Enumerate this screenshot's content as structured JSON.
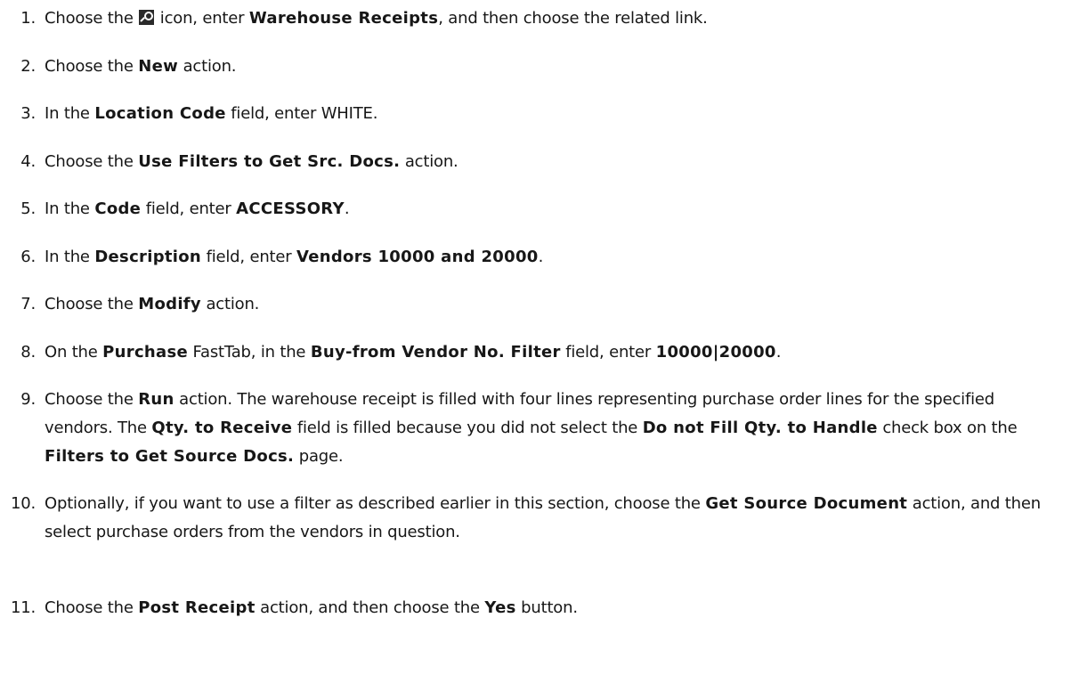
{
  "steps": [
    {
      "number": "1.",
      "parts": [
        {
          "t": "Choose the "
        },
        {
          "icon": "search-icon"
        },
        {
          "t": " icon, enter "
        },
        {
          "b": "Warehouse Receipts"
        },
        {
          "t": ", and then choose the related link."
        }
      ]
    },
    {
      "number": "2.",
      "parts": [
        {
          "t": "Choose the "
        },
        {
          "b": "New"
        },
        {
          "t": " action."
        }
      ]
    },
    {
      "number": "3.",
      "parts": [
        {
          "t": "In the "
        },
        {
          "b": "Location Code"
        },
        {
          "t": " field, enter WHITE."
        }
      ]
    },
    {
      "number": "4.",
      "parts": [
        {
          "t": "Choose the "
        },
        {
          "b": "Use Filters to Get Src. Docs."
        },
        {
          "t": " action."
        }
      ]
    },
    {
      "number": "5.",
      "parts": [
        {
          "t": "In the "
        },
        {
          "b": "Code"
        },
        {
          "t": " field, enter "
        },
        {
          "b": "ACCESSORY"
        },
        {
          "t": "."
        }
      ]
    },
    {
      "number": "6.",
      "parts": [
        {
          "t": "In the "
        },
        {
          "b": "Description"
        },
        {
          "t": " field, enter "
        },
        {
          "b": "Vendors 10000 and 20000"
        },
        {
          "t": "."
        }
      ]
    },
    {
      "number": "7.",
      "parts": [
        {
          "t": "Choose the "
        },
        {
          "b": "Modify"
        },
        {
          "t": " action."
        }
      ]
    },
    {
      "number": "8.",
      "parts": [
        {
          "t": "On the "
        },
        {
          "b": "Purchase"
        },
        {
          "t": " FastTab, in the "
        },
        {
          "b": "Buy-from Vendor No. Filter"
        },
        {
          "t": " field, enter "
        },
        {
          "b": "10000|20000"
        },
        {
          "t": "."
        }
      ]
    },
    {
      "number": "9.",
      "parts": [
        {
          "t": "Choose the "
        },
        {
          "b": "Run"
        },
        {
          "t": " action. The warehouse receipt is filled with four lines representing purchase order lines for the specified vendors. The "
        },
        {
          "b": "Qty. to Receive"
        },
        {
          "t": " field is filled because you did not select the "
        },
        {
          "b": "Do not Fill Qty. to Handle"
        },
        {
          "t": " check box on the "
        },
        {
          "b": "Filters to Get Source Docs."
        },
        {
          "t": " page."
        }
      ]
    },
    {
      "number": "10.",
      "parts": [
        {
          "t": "Optionally, if you want to use a filter as described earlier in this section, choose the "
        },
        {
          "b": "Get Source Document"
        },
        {
          "t": " action, and then select purchase orders from the vendors in question."
        }
      ]
    },
    {
      "number": "11.",
      "parts": [
        {
          "t": "Choose the "
        },
        {
          "b": "Post Receipt"
        },
        {
          "t": " action, and then choose the "
        },
        {
          "b": "Yes"
        },
        {
          "t": " button."
        }
      ]
    }
  ]
}
